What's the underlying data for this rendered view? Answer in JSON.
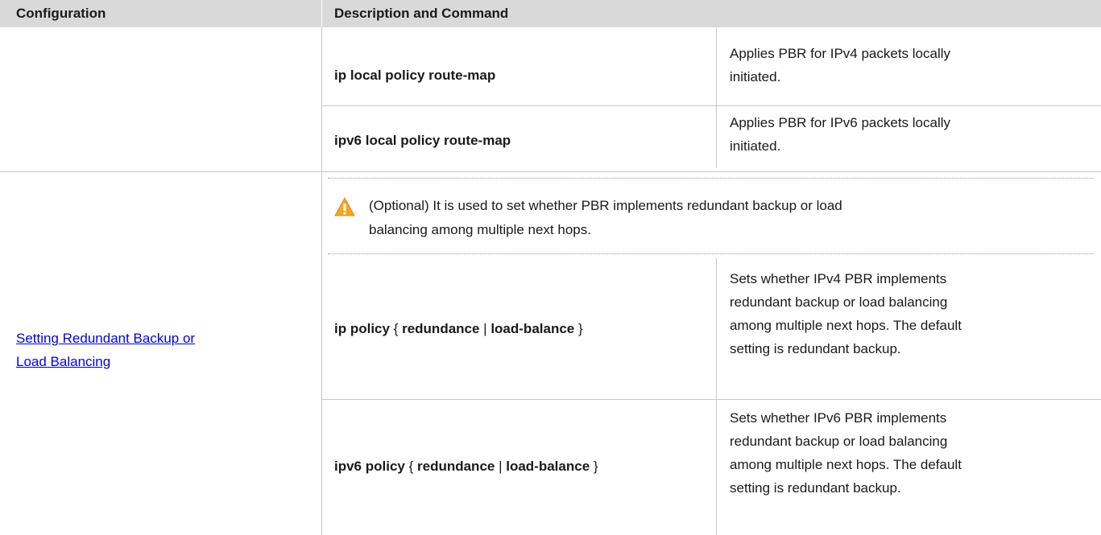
{
  "table": {
    "headers": {
      "configuration": "Configuration",
      "description": "Description and Command"
    },
    "row1": {
      "cmd1": "ip local policy route-map",
      "desc1_line1": "Applies PBR for IPv4 packets locally",
      "desc1_line2": "initiated.",
      "cmd2": "ipv6 local policy route-map",
      "desc2_line1": "Applies PBR for IPv6 packets locally",
      "desc2_line2": "initiated."
    },
    "row2": {
      "link_line1": "Setting Redundant Backup or",
      "link_line2": "Load Balancing",
      "note_line1": "(Optional) It is used to set whether PBR implements redundant backup or load",
      "note_line2": "balancing among multiple next hops.",
      "cmd3": {
        "p1": "ip policy",
        "p2": " { ",
        "p3": "redundance",
        "p4": " | ",
        "p5": "load-balance",
        "p6": " }"
      },
      "desc3": [
        "Sets whether IPv4 PBR implements",
        "redundant backup or load balancing",
        "among multiple next hops. The default",
        "setting is redundant backup."
      ],
      "cmd4": {
        "p1": "ipv6 policy",
        "p2": " { ",
        "p3": "redundance",
        "p4": " | ",
        "p5": "load-balance",
        "p6": " }"
      },
      "desc4": [
        "Sets whether IPv6 PBR implements",
        "redundant backup or load balancing",
        "among multiple next hops. The default",
        "setting is redundant backup."
      ]
    }
  },
  "icons": {
    "warning": "warning-icon",
    "warning_color": "#f5a623"
  },
  "colors": {
    "header_bg": "#d9d9d9",
    "link": "#0000ee",
    "grid": "#c8c8c8"
  }
}
